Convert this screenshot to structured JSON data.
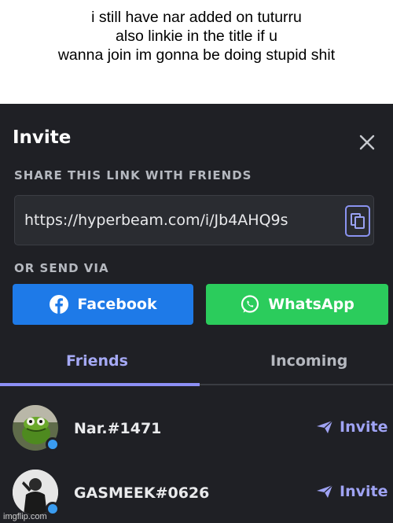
{
  "caption": {
    "line1": "i still have nar added on tuturru",
    "line2": "also linkie in the title if u",
    "line3": "wanna join im gonna be doing stupid shit"
  },
  "dialog": {
    "title": "Invite",
    "share_label": "SHARE THIS LINK WITH FRIENDS",
    "link": "https://hyperbeam.com/i/Jb4AHQ9s",
    "send_label": "OR SEND VIA",
    "facebook_label": "Facebook",
    "whatsapp_label": "WhatsApp",
    "tabs": [
      {
        "label": "Friends",
        "active": true
      },
      {
        "label": "Incoming",
        "active": false
      }
    ],
    "friends": [
      {
        "name": "Nar.#1471",
        "invite_label": "Invite",
        "status": "online-blue"
      },
      {
        "name": "GASMEEK#0626",
        "invite_label": "Invite",
        "status": "online-blue"
      }
    ]
  },
  "watermark": "imgflip.com",
  "colors": {
    "background": "#1f2025",
    "accent": "#8c8ff5",
    "facebook": "#1e7ae8",
    "whatsapp": "#2bcc5c"
  },
  "icons": [
    "close-icon",
    "copy-icon",
    "facebook-icon",
    "whatsapp-icon",
    "send-icon"
  ]
}
